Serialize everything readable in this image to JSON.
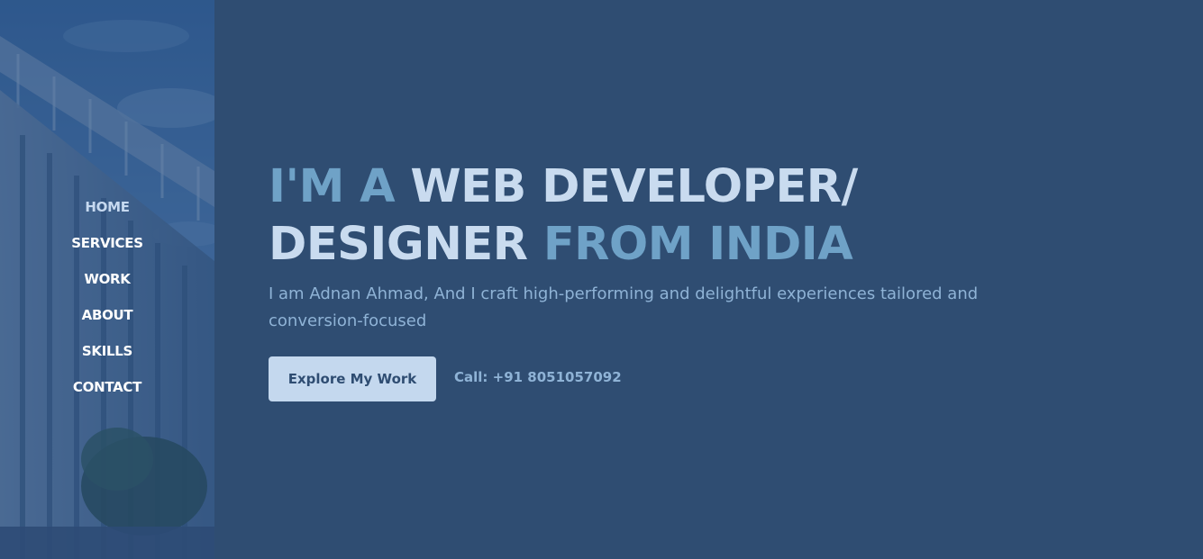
{
  "sidebar": {
    "background_image": "building-photo",
    "nav_items": [
      {
        "label": "HOME",
        "active": true
      },
      {
        "label": "SERVICES",
        "active": false
      },
      {
        "label": "WORK",
        "active": false
      },
      {
        "label": "ABOUT",
        "active": false
      },
      {
        "label": "SKILLS",
        "active": false
      },
      {
        "label": "CONTACT",
        "active": false
      }
    ]
  },
  "hero": {
    "title_part1": "I'M A",
    "title_part2": "WEB DEVELOPER/",
    "title_part3": "DESIGNER",
    "title_part4": "FROM INDIA",
    "subtitle": "I am Adnan Ahmad, And I craft high-performing and delightful experiences tailored and conversion-focused",
    "cta_label": "Explore My Work",
    "call_text": "Call: +91 8051057092"
  },
  "colors": {
    "background": "#2f4d72",
    "title_accent_dim": "#6fa2c7",
    "title_accent_light": "#c9dbef",
    "subtitle": "#8fb3d6",
    "button_bg": "#c4d8ee"
  }
}
